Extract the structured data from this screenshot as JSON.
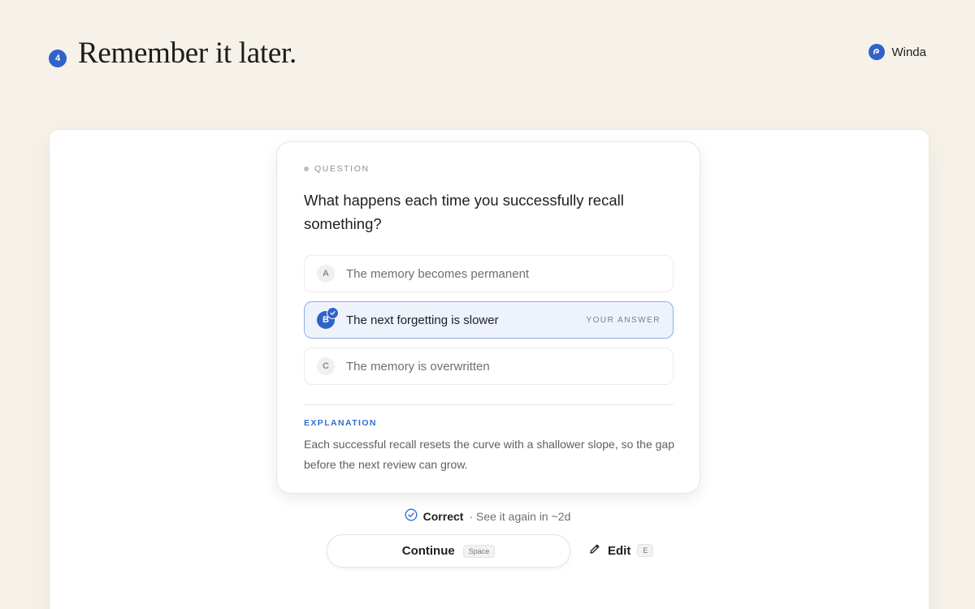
{
  "header": {
    "step_number": "4",
    "title": "Remember it later.",
    "brand_name": "Winda",
    "accent_color": "#2f63c9"
  },
  "card": {
    "eyebrow": "QUESTION",
    "question": "What happens each time you successfully recall something?",
    "options": [
      {
        "letter": "A",
        "text": "The memory becomes permanent",
        "selected": false
      },
      {
        "letter": "B",
        "text": "The next forgetting is slower",
        "selected": true,
        "tag": "YOUR ANSWER"
      },
      {
        "letter": "C",
        "text": "The memory is overwritten",
        "selected": false
      }
    ],
    "explanation_label": "EXPLANATION",
    "explanation": "Each successful recall resets the curve with a shallower slope, so the gap before the next review can grow."
  },
  "result": {
    "status": "Correct",
    "detail": "· See it again in ~2d",
    "icon": "check-circle-icon"
  },
  "actions": {
    "continue_label": "Continue",
    "continue_shortcut": "Space",
    "edit_label": "Edit",
    "edit_shortcut": "E",
    "edit_icon": "pencil-icon"
  }
}
